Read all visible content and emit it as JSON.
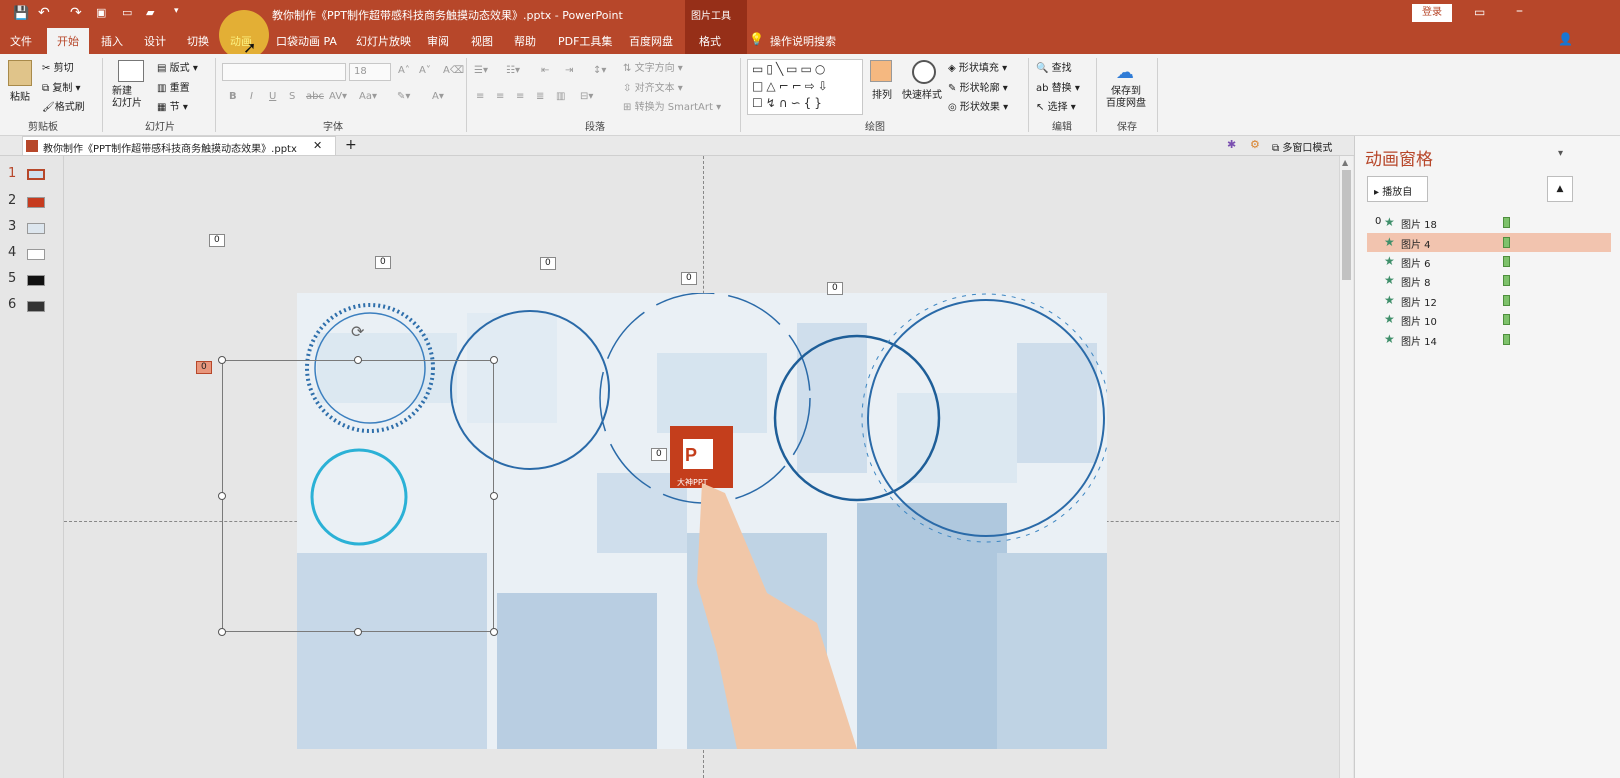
{
  "window": {
    "title": "教你制作《PPT制作超带感科技商务触摸动态效果》.pptx  -  PowerPoint",
    "context_tool": "图片工具",
    "login_label": "登录"
  },
  "tabs": [
    "文件",
    "开始",
    "插入",
    "设计",
    "切换",
    "动画",
    "口袋动画 PA",
    "幻灯片放映",
    "审阅",
    "视图",
    "帮助",
    "PDF工具集",
    "百度网盘",
    "格式"
  ],
  "active_tab": "开始",
  "tell_me": "操作说明搜索",
  "ribbon": {
    "clipboard": {
      "paste": "粘贴",
      "cut": "剪切",
      "copy": "复制",
      "format_painter": "格式刷",
      "label": "剪贴板"
    },
    "slides": {
      "new_slide": "新建\n幻灯片",
      "layout": "版式",
      "reset": "重置",
      "section": "节",
      "label": "幻灯片"
    },
    "font": {
      "size": "18",
      "label": "字体"
    },
    "paragraph": {
      "text_direction": "文字方向",
      "align_text": "对齐文本",
      "smartart": "转换为 SmartArt",
      "label": "段落"
    },
    "drawing": {
      "arrange": "排列",
      "quick_styles": "快速样式",
      "shape_fill": "形状填充",
      "shape_outline": "形状轮廓",
      "shape_effects": "形状效果",
      "label": "绘图"
    },
    "editing": {
      "find": "查找",
      "replace": "替换",
      "select": "选择",
      "label": "编辑"
    },
    "save": {
      "save_baidu": "保存到\n百度网盘",
      "label": "保存"
    }
  },
  "doc_tab": "教你制作《PPT制作超带感科技商务触摸动态效果》.pptx",
  "multi_window": "多窗口模式",
  "slides": [
    "1",
    "2",
    "3",
    "4",
    "5",
    "6"
  ],
  "tags": [
    "0",
    "0",
    "0",
    "0",
    "0",
    "0",
    "0"
  ],
  "anim_pane": {
    "title": "动画窗格",
    "play_from": "播放自",
    "items": [
      {
        "prefix": "0",
        "label": "图片 18"
      },
      {
        "prefix": "",
        "label": "图片 4"
      },
      {
        "prefix": "",
        "label": "图片 6"
      },
      {
        "prefix": "",
        "label": "图片 8"
      },
      {
        "prefix": "",
        "label": "图片 12"
      },
      {
        "prefix": "",
        "label": "图片 10"
      },
      {
        "prefix": "",
        "label": "图片 14"
      }
    ]
  },
  "logo_text": "大神PPT",
  "colors": {
    "accent": "#b7472a",
    "selection": "#f2c4af",
    "anim_bar": "#7ec26b"
  }
}
